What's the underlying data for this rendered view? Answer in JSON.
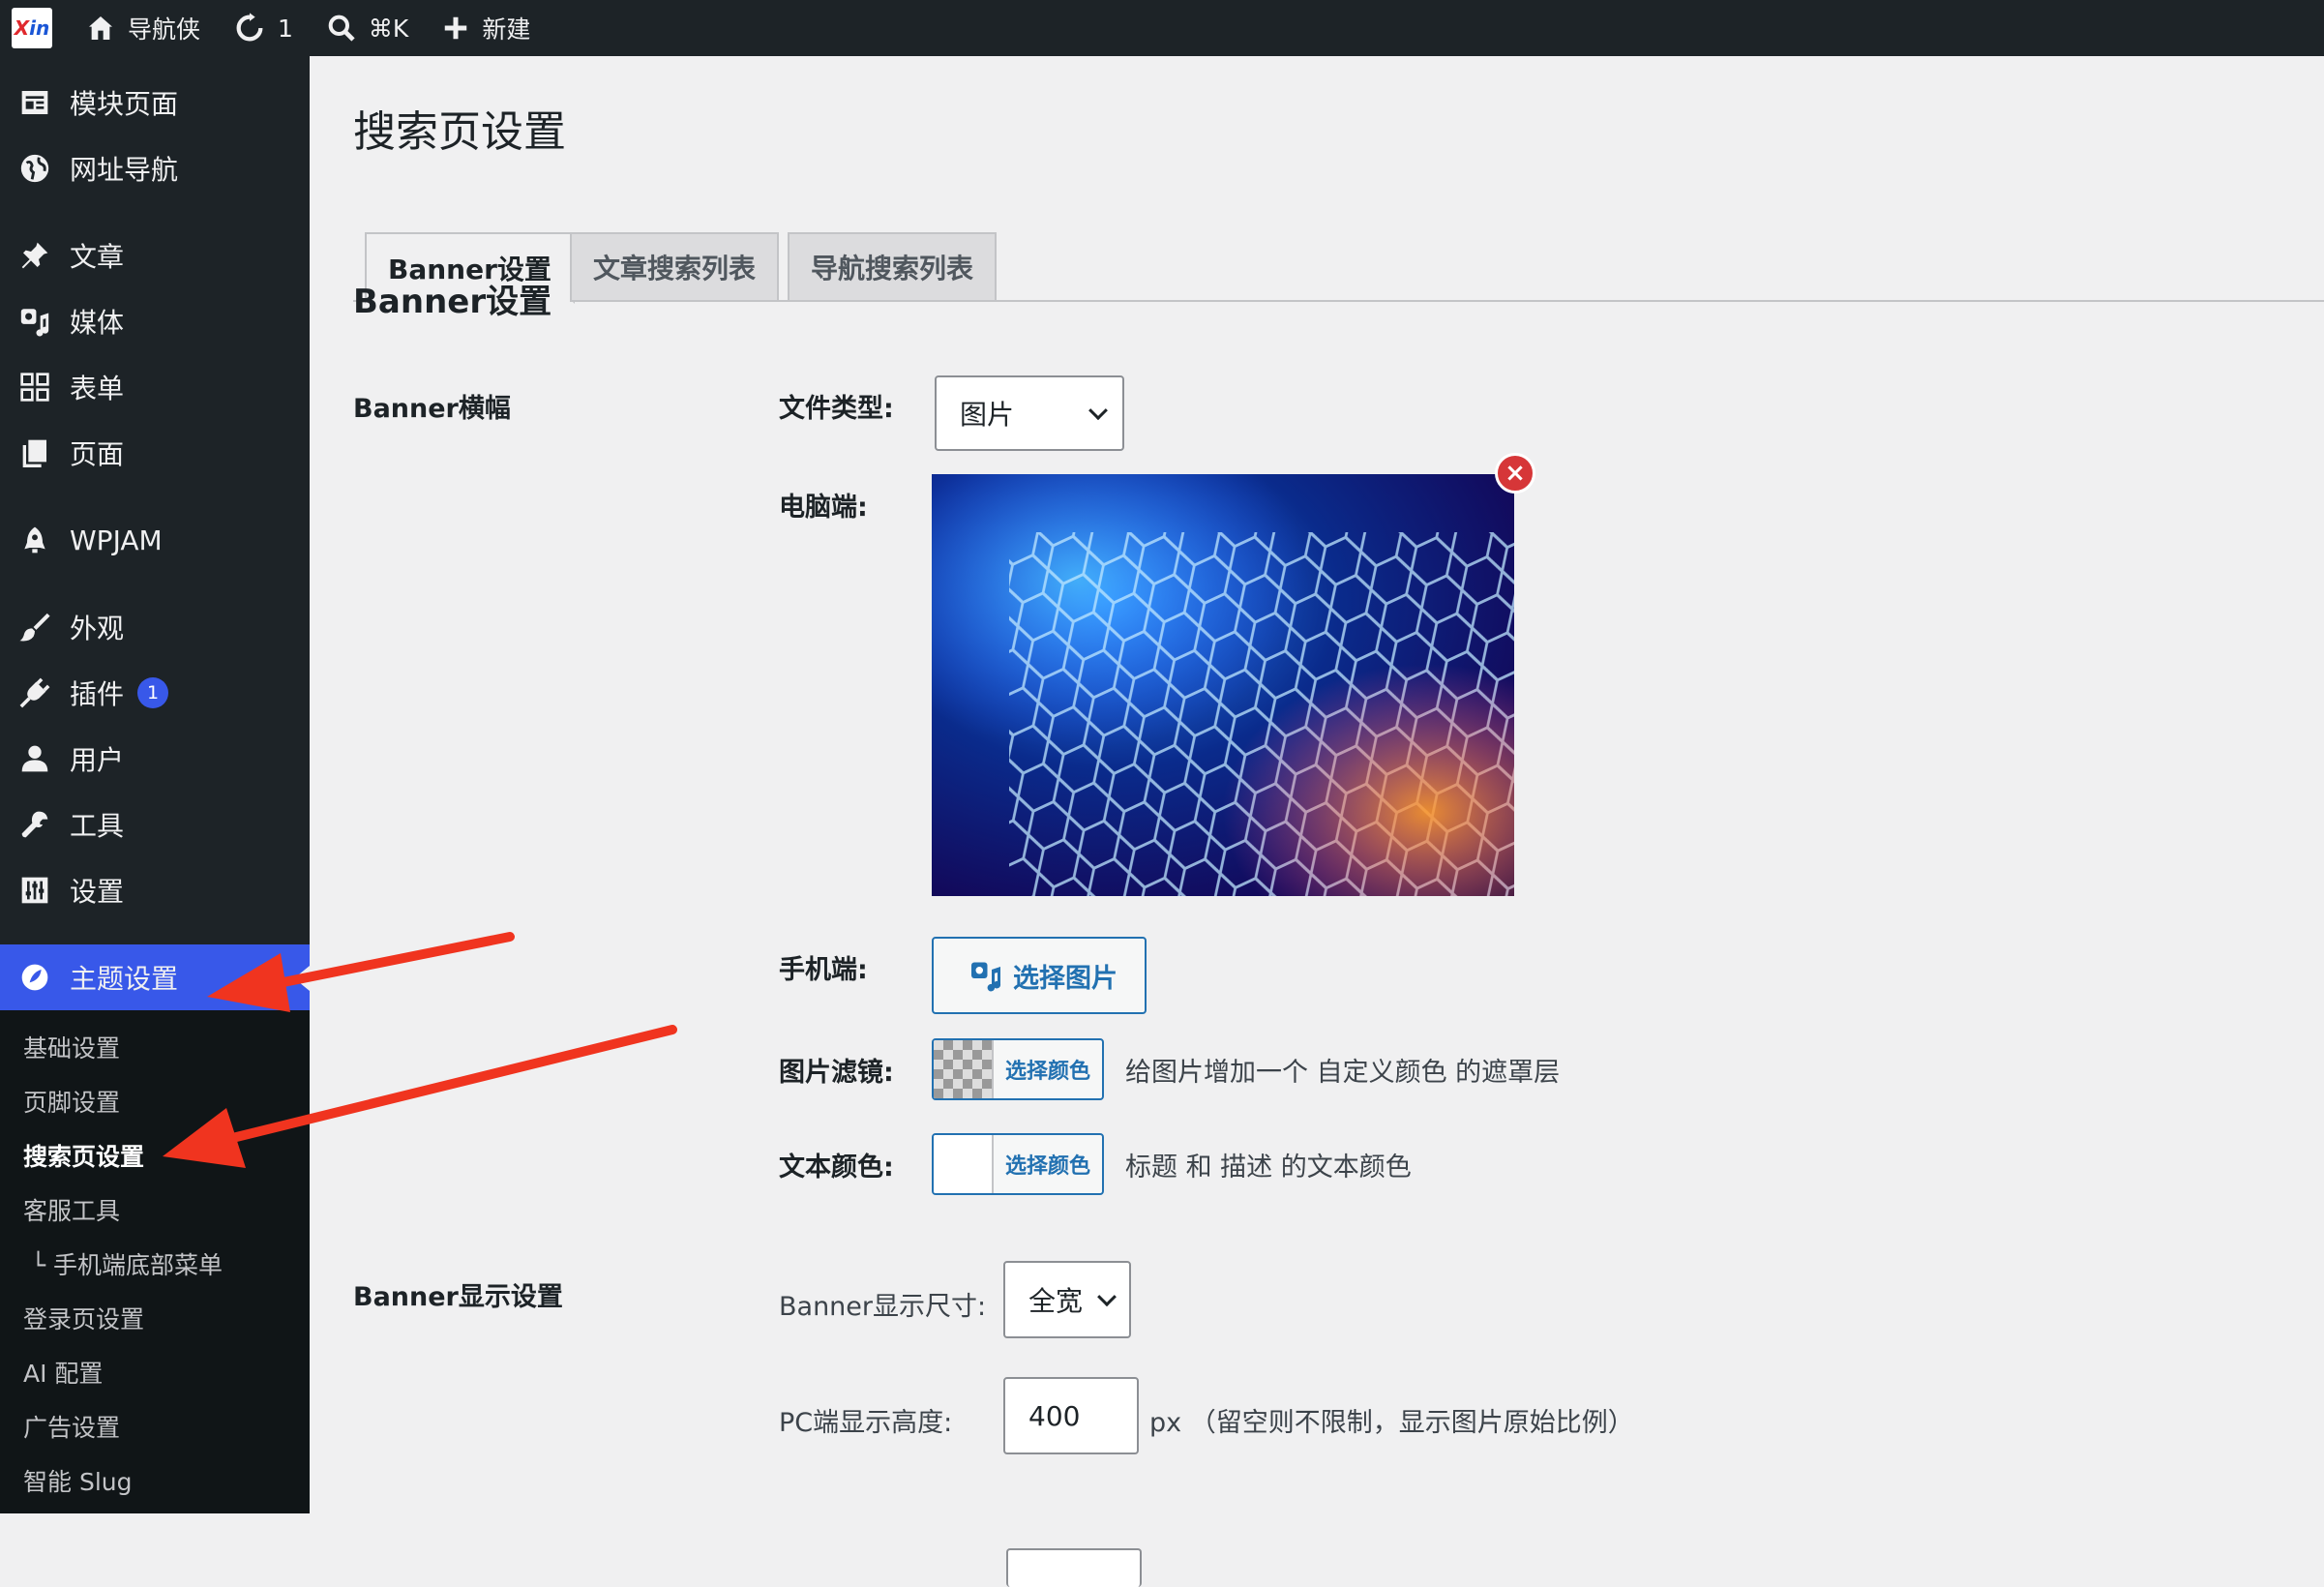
{
  "topbar": {
    "site_name": "导航侠",
    "updates_count": "1",
    "search_shortcut": "⌘K",
    "new_label": "新建"
  },
  "sidebar": {
    "items": [
      {
        "label": "模块页面",
        "icon": "layout-icon"
      },
      {
        "label": "网址导航",
        "icon": "globe-icon"
      },
      {
        "label": "文章",
        "icon": "pin-icon"
      },
      {
        "label": "媒体",
        "icon": "media-icon"
      },
      {
        "label": "表单",
        "icon": "grid-icon"
      },
      {
        "label": "页面",
        "icon": "page-icon"
      },
      {
        "label": "WPJAM",
        "icon": "rocket-icon"
      },
      {
        "label": "外观",
        "icon": "brush-icon"
      },
      {
        "label": "插件",
        "icon": "plugin-icon",
        "badge": "1"
      },
      {
        "label": "用户",
        "icon": "user-icon"
      },
      {
        "label": "工具",
        "icon": "wrench-icon"
      },
      {
        "label": "设置",
        "icon": "sliders-icon"
      },
      {
        "label": "主题设置",
        "icon": "palette-icon"
      }
    ],
    "submenu": [
      "基础设置",
      "页脚设置",
      "搜索页设置",
      "客服工具",
      "└ 手机端底部菜单",
      "登录页设置",
      "AI 配置",
      "广告设置",
      "智能 Slug"
    ]
  },
  "main": {
    "title": "搜索页设置",
    "tabs": [
      "Banner设置",
      "文章搜索列表",
      "导航搜索列表"
    ],
    "section_title": "Banner设置",
    "banner_row": "Banner横幅",
    "file_type_label": "文件类型:",
    "file_type_value": "图片",
    "desktop_label": "电脑端:",
    "remove_symbol": "×",
    "mobile_label": "手机端:",
    "select_image_label": "选择图片",
    "filter_label": "图片滤镜:",
    "select_color_label": "选择颜色",
    "filter_desc": "给图片增加一个 自定义颜色 的遮罩层",
    "text_color_label": "文本颜色:",
    "text_color_desc": "标题 和 描述 的文本颜色",
    "display_row": "Banner显示设置",
    "display_size_label": "Banner显示尺寸:",
    "display_size_value": "全宽",
    "pc_height_label": "PC端显示高度:",
    "pc_height_value": "400",
    "pc_height_unit": "px （留空则不限制，显示图片原始比例）"
  },
  "colors": {
    "admin_bar": "#1d2327",
    "accent": "#3858e9",
    "link": "#2271b1",
    "annotation_arrow": "#f0341f"
  }
}
